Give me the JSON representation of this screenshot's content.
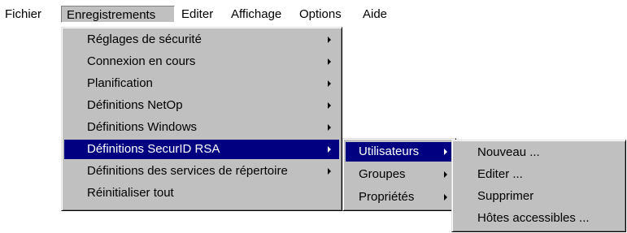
{
  "menubar": {
    "items": [
      "Fichier",
      "Enregistrements",
      "Editer",
      "Affichage",
      "Options",
      "Aide"
    ]
  },
  "menus": {
    "enregistrements": [
      "Réglages de sécurité",
      "Connexion en cours",
      "Planification",
      "Définitions NetOp",
      "Définitions Windows",
      "Définitions SecurID RSA",
      "Définitions des services de répertoire",
      "Réinitialiser tout"
    ],
    "securid": [
      "Utilisateurs",
      "Groupes",
      "Propriétés"
    ],
    "utilisateurs": [
      "Nouveau ...",
      "Editer ...",
      "Supprimer",
      "Hôtes accessibles ..."
    ]
  },
  "colors": {
    "menu_face": "#c0c0c0",
    "selection": "#000080",
    "selection_text": "#ffffff"
  },
  "icons": {
    "submenu_indicator": "right-triangle-arrow"
  }
}
